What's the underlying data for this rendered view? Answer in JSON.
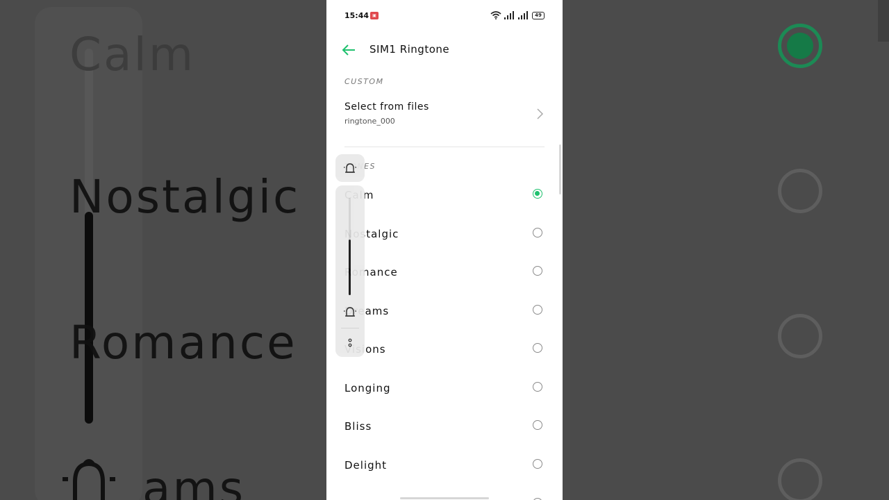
{
  "status_bar": {
    "time": "15:44",
    "battery": "49",
    "icons": [
      "recording-icon",
      "wifi-icon",
      "signal-icon",
      "signal-icon",
      "battery-icon"
    ]
  },
  "app_bar": {
    "title": "SIM1 Ringtone",
    "back_icon": "back-arrow-icon"
  },
  "custom_section": {
    "header": "CUSTOM",
    "select_title": "Select from files",
    "select_subtitle": "ringtone_000"
  },
  "tones_section": {
    "header": "TONES",
    "items": [
      {
        "label": "Calm",
        "selected": true
      },
      {
        "label": "Nostalgic",
        "selected": false
      },
      {
        "label": "Romance",
        "selected": false
      },
      {
        "label": "Dreams",
        "selected": false
      },
      {
        "label": "Visions",
        "selected": false
      },
      {
        "label": "Longing",
        "selected": false
      },
      {
        "label": "Bliss",
        "selected": false
      },
      {
        "label": "Delight",
        "selected": false
      }
    ]
  },
  "volume_overlay": {
    "level": 0.57,
    "icons": [
      "bell-icon",
      "bell-icon",
      "more-options-icon"
    ]
  },
  "colors": {
    "accent": "#1fc16e",
    "background": "#4b4b4b",
    "screen": "#ffffff",
    "recording": "#e0494e"
  }
}
